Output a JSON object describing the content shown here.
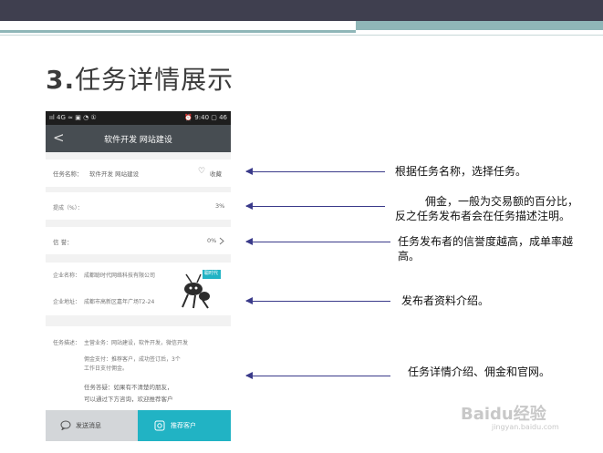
{
  "slide": {
    "title_num": "3.",
    "title_text": "任务详情展示"
  },
  "phone": {
    "status_left": "ııl 4G ≈ ▣ ◔ ①",
    "status_right": "⏰ 9:40 ▢ 46",
    "nav_back": "<",
    "nav_title": "软件开发  网站建设",
    "task_name_label": "任务名称：",
    "task_name_value": "软件开发  网站建设",
    "favorite_icon": "♡",
    "favorite_label": "收藏",
    "commission_label": "提成（%）：",
    "commission_value": "3%",
    "reputation_label": "信      誉：",
    "reputation_value": "0%",
    "company_name_label": "企业名称：",
    "company_name_value": "成都聪时代网络科技有限公司",
    "company_addr_label": "企业地址：",
    "company_addr_value": "成都市高新区嘉年广场T2-24",
    "logo_badge": "聪时代",
    "desc_label": "任务描述：",
    "desc_line1": "主营业务：网站建设，软件开发，微信开发",
    "desc_line2": "佣金支付：推荐客户，成功签订后，3个",
    "desc_line3": "工作日支付佣金。",
    "desc_line4": "任务答疑：如果有不清楚的朋友，",
    "desc_line5": "可以通过下方咨询，欢迎推荐客户",
    "btn_message": "发送消息",
    "btn_recommend": "推荐客户"
  },
  "notes": {
    "n1": "根据任务名称，选择任务。",
    "n2_line1": "佣金，一般为交易额的百分比，",
    "n2_line2": "反之任务发布者会在任务描述注明。",
    "n3_line1": "任务发布者的信誉度越高，成单率越",
    "n3_line2": "高。",
    "n4": "发布者资料介绍。",
    "n5": "任务详情介绍、佣金和官网。"
  },
  "watermark": {
    "main": "Baidu经验",
    "sub": "jingyan.baidu.com"
  },
  "colors": {
    "header_dark": "#3f3f4f",
    "header_teal": "#8fb6b8",
    "phone_nav": "#474d52",
    "accent": "#21b3c4",
    "arrow": "#3a3a8a"
  }
}
